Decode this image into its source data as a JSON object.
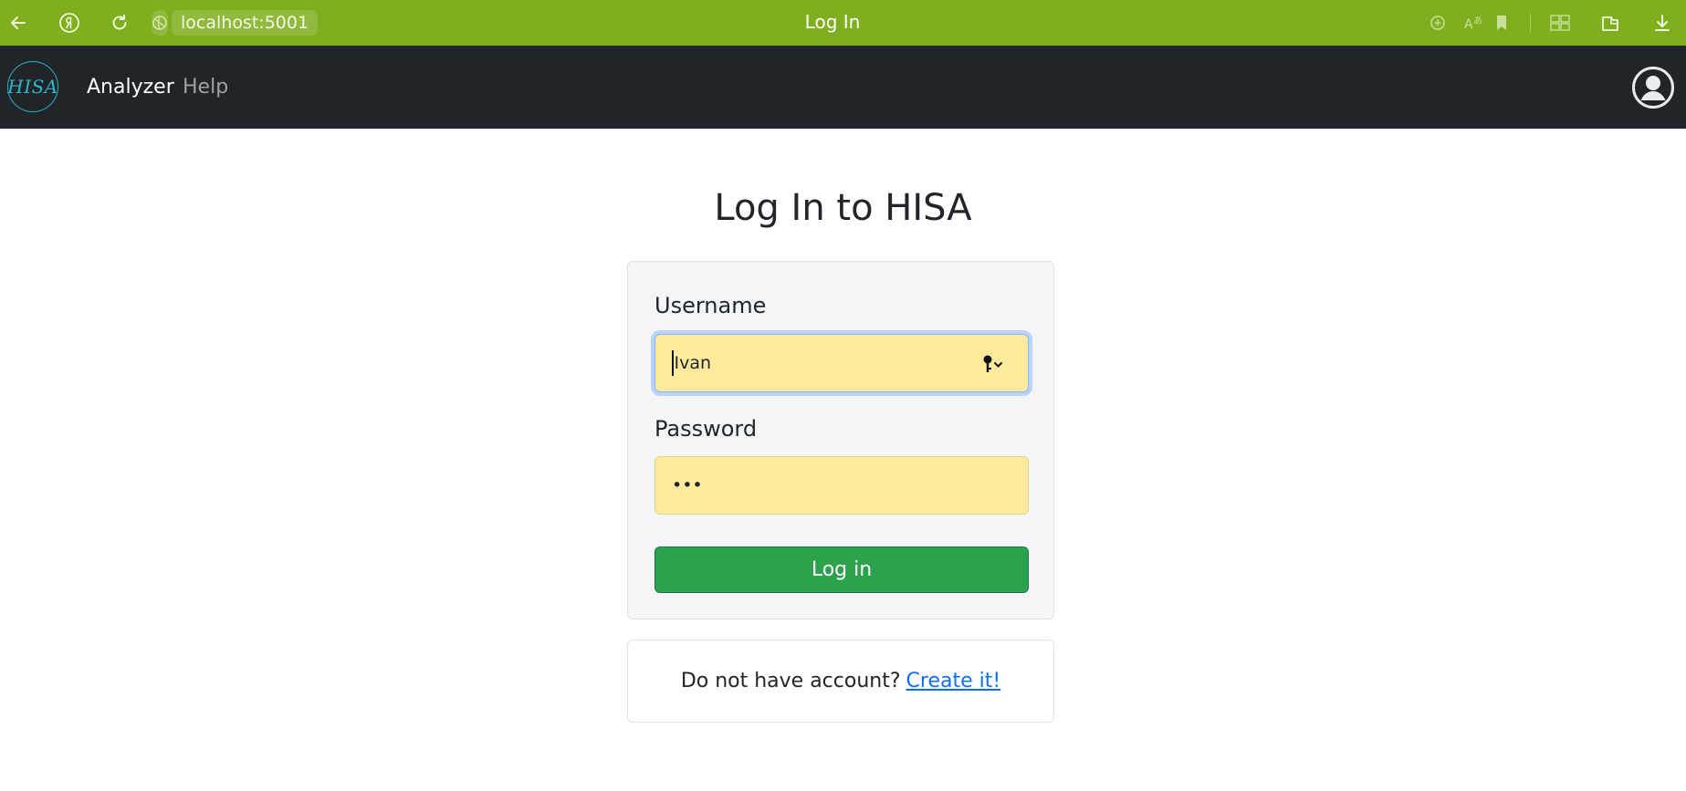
{
  "browser": {
    "url": "localhost:5001",
    "tab_title": "Log In",
    "icons": [
      "back-arrow-icon",
      "yandex-icon",
      "reload-icon",
      "site-info-icon",
      "zoom-icon",
      "translate-icon",
      "bookmark-icon",
      "extensions-icon",
      "collections-icon",
      "download-icon"
    ]
  },
  "navbar": {
    "logo_text": "HISA",
    "links": [
      "Analyzer",
      "Help"
    ],
    "active_link": "Analyzer",
    "account_icon": "user-circle-icon"
  },
  "page": {
    "title": "Log In to HISA"
  },
  "login_form": {
    "username_label": "Username",
    "username_value": "Ivan",
    "password_label": "Password",
    "password_masked": "•••",
    "submit_label": "Log in"
  },
  "signup": {
    "prompt": "Do not have account?",
    "link_text": "Create it!"
  },
  "colors": {
    "browser_bar": "#7fae1f",
    "navbar": "#212529",
    "autofill_input": "#feea9c",
    "login_button": "#2ba34d",
    "link": "#0d6efd"
  }
}
